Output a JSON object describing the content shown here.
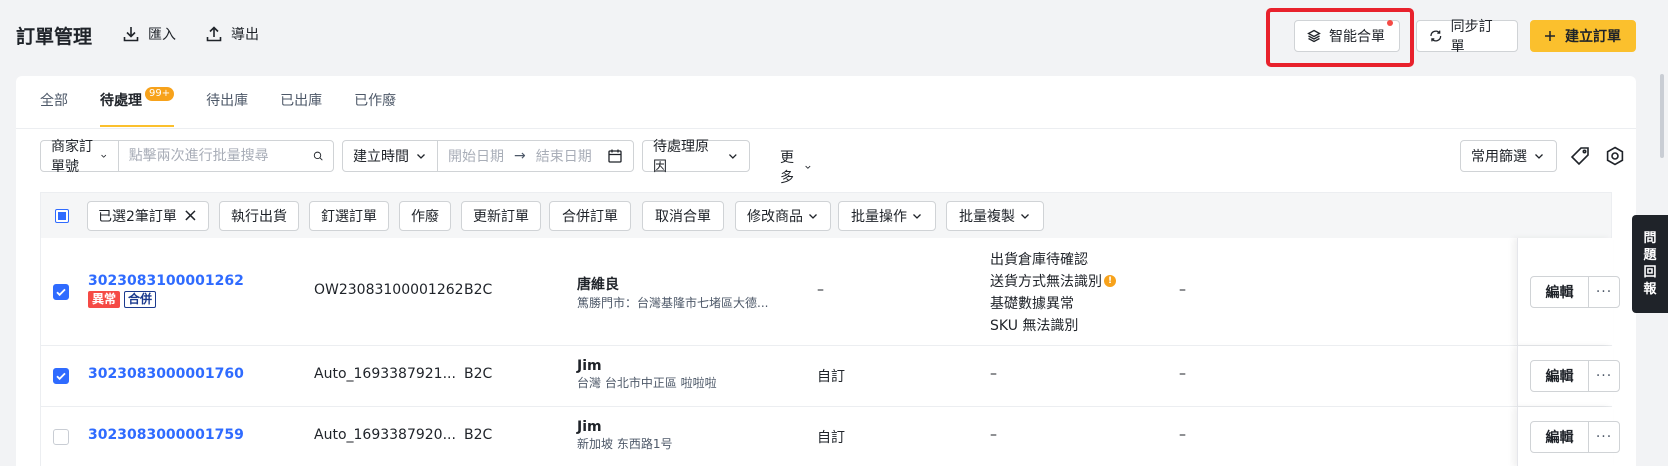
{
  "header": {
    "title": "訂單管理",
    "import_label": "匯入",
    "export_label": "導出",
    "smart_merge_label": "智能合單",
    "sync_label": "同步訂單",
    "create_label": "建立訂單"
  },
  "tabs": [
    {
      "label": "全部"
    },
    {
      "label": "待處理",
      "badge": "99+",
      "active": true
    },
    {
      "label": "待出庫"
    },
    {
      "label": "已出庫"
    },
    {
      "label": "已作廢"
    }
  ],
  "filters": {
    "merchant_select": "商家訂單號",
    "search_placeholder": "點擊兩次進行批量搜尋",
    "date_select": "建立時間",
    "start_placeholder": "開始日期",
    "date_arrow": "→",
    "end_placeholder": "結束日期",
    "reason_select": "待處理原因",
    "more_label": "更多",
    "common_filter": "常用篩選"
  },
  "bulk": {
    "selected_label": "已選2筆訂單",
    "clear_icon": "×",
    "ship": "執行出貨",
    "pick": "釘選訂單",
    "void": "作廢",
    "update": "更新訂單",
    "merge": "合併訂單",
    "unmerge": "取消合單",
    "modify_goods": "修改商品",
    "batch_ops": "批量操作",
    "batch_copy": "批量複製"
  },
  "rows": [
    {
      "checked": true,
      "order_no": "3023083100001262",
      "badges": [
        "異常",
        "合併"
      ],
      "platform_no": "OW23083100001262",
      "type": "B2C",
      "recipient": "唐維良",
      "address": "篤勝門市：台灣基隆市七堵區大德...",
      "source": "–",
      "reasons": [
        "出貨倉庫待確認",
        "送貨方式無法識別",
        "基礎數據異常",
        "SKU 無法識別"
      ],
      "extra": "–",
      "edit_label": "編輯",
      "more_label": "···"
    },
    {
      "checked": true,
      "order_no": "3023083000001760",
      "platform_no": "Auto_1693387921...",
      "type": "B2C",
      "recipient": "Jim",
      "address": "台灣 台北市中正區 啦啦啦",
      "source": "自訂",
      "reason": "–",
      "extra": "–",
      "edit_label": "編輯",
      "more_label": "···"
    },
    {
      "checked": false,
      "order_no": "3023083000001759",
      "platform_no": "Auto_1693387920...",
      "type": "B2C",
      "recipient": "Jim",
      "address": "新加坡 东西路1号",
      "source": "自訂",
      "reason": "–",
      "extra": "–",
      "edit_label": "編輯",
      "more_label": "···"
    }
  ],
  "feedback": {
    "label": "問題回報",
    "chars": [
      "問",
      "題",
      "回",
      "報"
    ]
  },
  "colors": {
    "accent": "#fbc02d",
    "link": "#2f6bff",
    "danger": "#f54a45",
    "badge_orange": "#f7a21b",
    "highlight": "#e8212c"
  },
  "icons": {
    "import": "download-icon",
    "export": "upload-icon",
    "smart_merge": "layers-icon",
    "sync": "refresh-icon",
    "create": "plus-icon",
    "search": "search-icon",
    "calendar": "calendar-icon",
    "tag": "tag-icon",
    "settings": "settings-icon"
  }
}
